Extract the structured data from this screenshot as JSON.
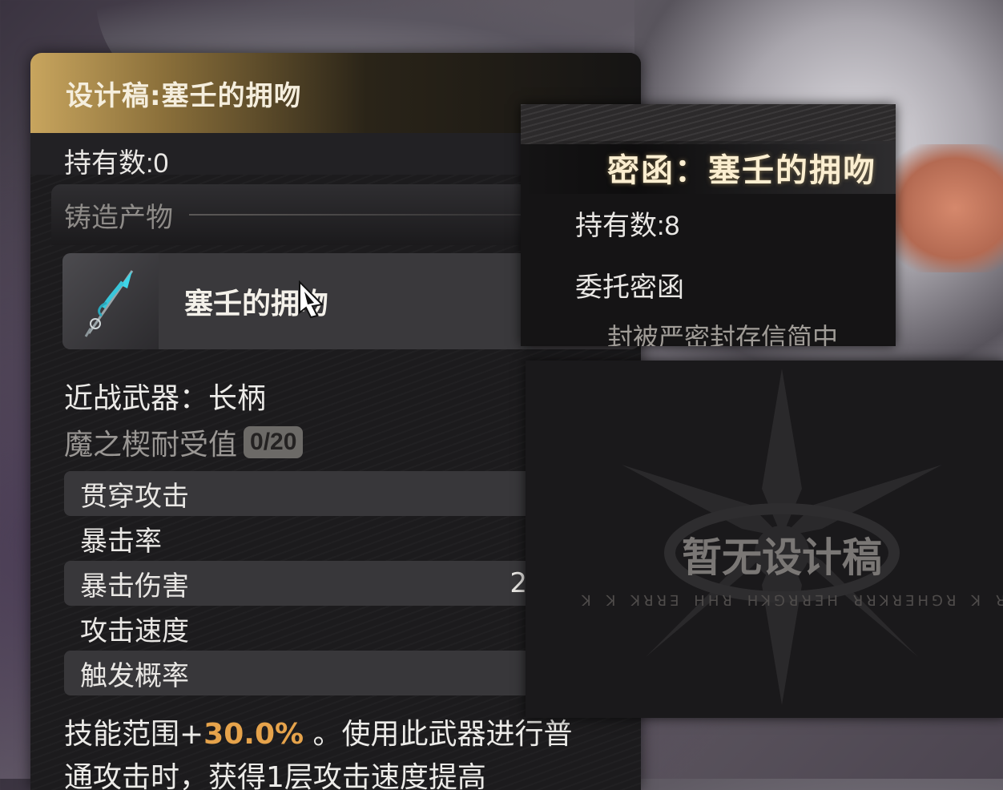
{
  "weapon_panel": {
    "title": "设计稿:塞壬的拥吻",
    "holding": "持有数:0",
    "section_label": "铸造产物",
    "item_name": "塞壬的拥吻",
    "weapon_type": "近战武器：长柄",
    "demon_label": "魔之楔耐受值",
    "demon_value": "0/20",
    "stats": [
      {
        "name": "贯穿攻击",
        "value": ""
      },
      {
        "name": "暴击率",
        "value": ""
      },
      {
        "name": "暴击伤害",
        "value": "2"
      },
      {
        "name": "攻击速度",
        "value": ""
      },
      {
        "name": "触发概率",
        "value": ""
      }
    ],
    "desc_prefix": "技能范围+",
    "desc_highlight": "30.0%",
    "desc_suffix": " 。使用此武器进行普",
    "desc_line2": "通攻击时，获得1层攻击速度提高"
  },
  "letter_panel": {
    "title": "密函：塞壬的拥吻",
    "holding": "持有数:8",
    "kind": "委托密函",
    "desc": "封被严密封存信简中"
  },
  "blueprint_panel": {
    "empty_text": "暂无设计稿",
    "rune_text": "ꓘ ꓘ ꓘꓤꓤꓱ ꓧꓧꓤ ꓧꓘꓨꓤꓤꓱꓧ ꓤꓤꓘꓤꓱꓧꓨꓤ ꓘ ꓤ ꓧ"
  },
  "colors": {
    "highlight": "#e6a34b",
    "title_gold": "#c8a55e"
  }
}
